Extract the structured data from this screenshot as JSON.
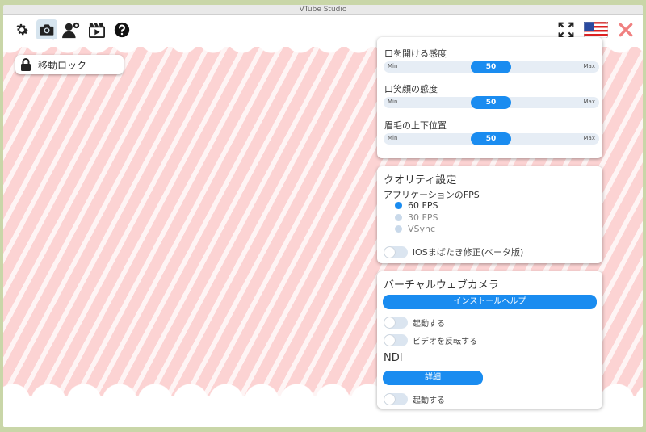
{
  "window": {
    "title": "VTube Studio"
  },
  "toolbar": {
    "icons": [
      "gear-icon",
      "camera-icon",
      "user-settings-icon",
      "clapperboard-icon",
      "help-icon",
      "fullscreen-icon",
      "us-flag-icon",
      "close-icon"
    ],
    "accent": "#1a8cf0",
    "close_color": "#f08080"
  },
  "lock": {
    "label": "移動ロック"
  },
  "sliders": [
    {
      "label": "口を開ける感度",
      "value": "50",
      "min": "Min",
      "max": "Max"
    },
    {
      "label": "口笑顔の感度",
      "value": "50",
      "min": "Min",
      "max": "Max"
    },
    {
      "label": "眉毛の上下位置",
      "value": "50",
      "min": "Min",
      "max": "Max"
    }
  ],
  "quality": {
    "title": "クオリティ設定",
    "fps_label": "アプリケーションのFPS",
    "options": [
      "60 FPS",
      "30 FPS",
      "VSync"
    ],
    "selected": "60 FPS",
    "ios_toggle": "iOSまばたき修正(ベータ版)"
  },
  "webcam": {
    "title": "バーチャルウェブカメラ",
    "install_help": "インストールヘルプ",
    "start": "起動する",
    "flip": "ビデオを反転する",
    "ndi_title": "NDI",
    "details": "詳細",
    "ndi_start": "起動する"
  }
}
